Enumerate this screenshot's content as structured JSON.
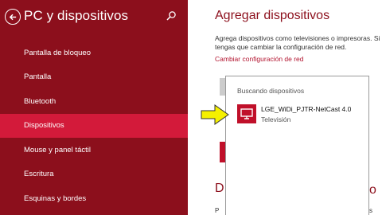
{
  "sidebar": {
    "title": "PC y dispositivos",
    "items": [
      {
        "label": "Pantalla de bloqueo"
      },
      {
        "label": "Pantalla"
      },
      {
        "label": "Bluetooth"
      },
      {
        "label": "Dispositivos",
        "active": true
      },
      {
        "label": "Mouse y panel táctil"
      },
      {
        "label": "Escritura"
      },
      {
        "label": "Esquinas y bordes"
      }
    ]
  },
  "main": {
    "title": "Agregar dispositivos",
    "description_line1": "Agrega dispositivos como televisiones o impresoras. Si n",
    "description_line2": "tengas que cambiar la configuración de red.",
    "link": "Cambiar configuración de red",
    "section_title_fragment": "D",
    "bottom_fragment": "P",
    "right_fragment1": "o",
    "right_fragment2": "s"
  },
  "flyout": {
    "title": "Buscando dispositivos",
    "devices": [
      {
        "name": "LGE_WiDi_PJTR-NetCast 4.0",
        "type": "Televisión"
      }
    ]
  },
  "colors": {
    "sidebar_bg": "#8c0f1c",
    "active_item": "#d31a3a",
    "accent": "#c0102a",
    "arrow": "#f5f000"
  },
  "icons": [
    "back-arrow-icon",
    "search-icon",
    "monitor-icon",
    "pointer-arrow-icon"
  ]
}
